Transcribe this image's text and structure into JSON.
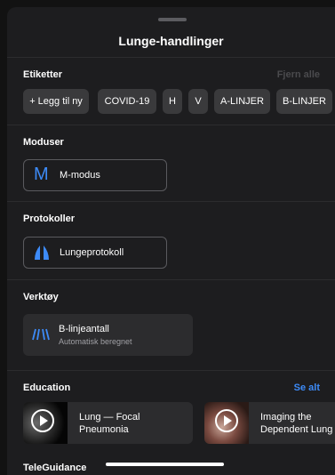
{
  "header": {
    "title": "Lunge-handlinger"
  },
  "labels": {
    "title": "Etiketter",
    "remove_all": "Fjern alle",
    "chips": [
      "+ Legg til ny",
      "COVID-19",
      "H",
      "V",
      "A-LINJER",
      "B-LINJER"
    ]
  },
  "modes": {
    "title": "Moduser",
    "item": "M-modus",
    "icon_letter": "M"
  },
  "protocols": {
    "title": "Protokoller",
    "item": "Lungeprotokoll"
  },
  "tools": {
    "title": "Verktøy",
    "item": "B-linjeantall",
    "subtitle": "Automatisk beregnet"
  },
  "education": {
    "title": "Education",
    "see_all": "Se alt",
    "items": [
      {
        "line1": "Lung — Focal",
        "line2": "Pneumonia"
      },
      {
        "line1": "Imaging the",
        "line2": "Dependent Lung"
      }
    ]
  },
  "next_section": {
    "title": "TeleGuidance"
  },
  "colors": {
    "accent": "#3d8bf8",
    "remove_all": "#4a4a4d",
    "chip_bg": "#3a3a3c",
    "sheet_bg": "#1d1d1f"
  },
  "icons": {
    "mode": "m-mode-icon",
    "protocol": "lung-icon",
    "tool": "b-lines-icon",
    "play": "play-icon"
  }
}
